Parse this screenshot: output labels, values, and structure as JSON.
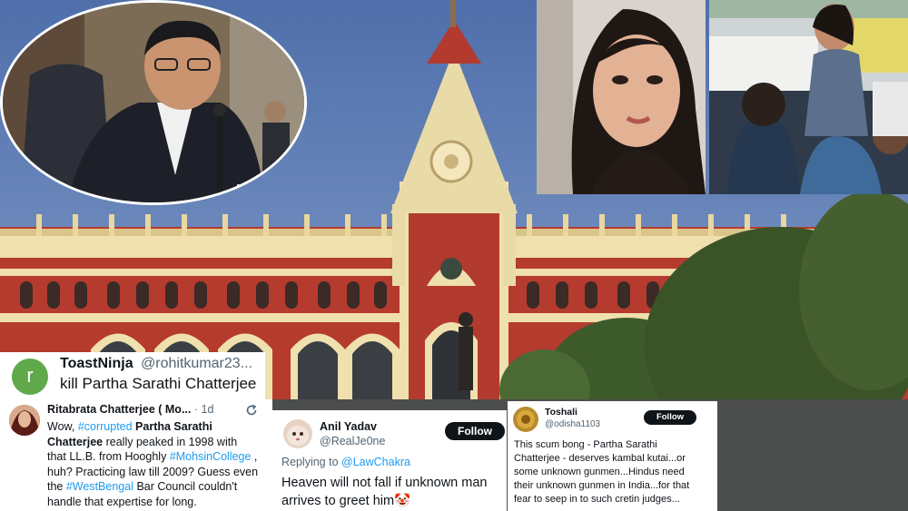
{
  "scene": {
    "description_colors": {
      "sky": "#6f8ec2",
      "brick": "#b33a2e",
      "cream": "#efe3b4"
    }
  },
  "post_toast": {
    "avatar_letter": "r",
    "name": "ToastNinja",
    "handle": "@rohitkumar23...",
    "text": "kill Partha Sarathi Chatterjee"
  },
  "post_ritabrata": {
    "name": "Ritabrata Chatterjee ( Mo...",
    "time": "· 1d",
    "lines": [
      [
        "Wow, ",
        "#corrupted",
        " Partha Sarathi"
      ],
      [
        "Chatterjee really peaked in 1998 with"
      ],
      [
        "that LL.B. from Hooghly ",
        "#MohsinCollege",
        " ,"
      ],
      [
        "huh? Practicing law till 2009? Guess even"
      ],
      [
        "the ",
        "#WestBengal",
        " Bar Council couldn't"
      ],
      [
        "handle that expertise for long."
      ]
    ],
    "p1": "Wow, ",
    "tag1": "#corrupted",
    "p2": " Partha Sarathi",
    "p3": "Chatterjee",
    "p4": " really peaked in 1998 with",
    "p5": "that LL.B. from Hooghly ",
    "tag2": "#MohsinCollege",
    "p6": " ,",
    "p7": "huh? Practicing law till 2009? Guess even",
    "p8": "the ",
    "tag3": "#WestBengal",
    "p9": " Bar Council couldn't",
    "p10": "handle that expertise for long."
  },
  "post_anil": {
    "name": "Anil Yadav",
    "handle": "@RealJe0ne",
    "follow": "Follow",
    "replying_prefix": "Replying to ",
    "replying_to": "@LawChakra",
    "line1": "Heaven will not fall if unknown man",
    "line2": "arrives to greet him🤡"
  },
  "post_toshali": {
    "name": "Toshali",
    "handle": "@odisha1103",
    "follow": "Follow",
    "lines": [
      "This scum bong - Partha Sarathi",
      "Chatterjee - deserves kambal kutai...or",
      "some unknown gunmen...Hindus need",
      "their unknown gunmen in India...for that",
      "fear to seep in to such cretin judges..."
    ]
  }
}
